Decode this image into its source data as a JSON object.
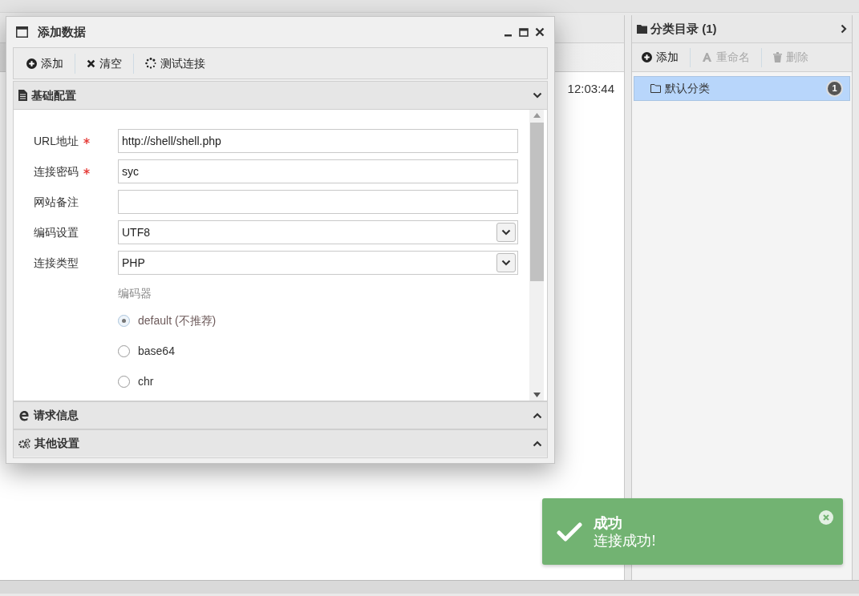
{
  "background": {
    "timestamp": "12:03:44"
  },
  "category_panel": {
    "title": "分类目录 (1)",
    "toolbar": [
      {
        "label": "添加",
        "disabled": false
      },
      {
        "label": "重命名",
        "disabled": true
      },
      {
        "label": "删除",
        "disabled": true
      }
    ],
    "items": [
      {
        "label": "默认分类",
        "count": "1",
        "selected": true
      }
    ]
  },
  "dialog": {
    "title": "添加数据",
    "toolbar": [
      {
        "label": "添加"
      },
      {
        "label": "清空"
      },
      {
        "label": "测试连接"
      }
    ],
    "sections": [
      {
        "title": "基础配置",
        "expanded": true
      },
      {
        "title": "请求信息",
        "expanded": false
      },
      {
        "title": "其他设置",
        "expanded": false
      }
    ],
    "fields": [
      {
        "kind": "text",
        "label": "URL地址",
        "required": true,
        "value": "http://shell/shell.php"
      },
      {
        "kind": "text",
        "label": "连接密码",
        "required": true,
        "value": "syc"
      },
      {
        "kind": "text",
        "label": "网站备注",
        "required": false
      },
      {
        "kind": "select",
        "label": "编码设置",
        "required": false,
        "value": "UTF8"
      },
      {
        "kind": "select",
        "label": "连接类型",
        "required": false,
        "value": "PHP"
      }
    ],
    "encoder": {
      "label": "编码器",
      "options": [
        {
          "label": "default (不推荐)",
          "selected": true
        },
        {
          "label": "base64",
          "selected": false
        },
        {
          "label": "chr",
          "selected": false
        }
      ]
    }
  },
  "toast": {
    "title": "成功",
    "message": "连接成功!"
  }
}
